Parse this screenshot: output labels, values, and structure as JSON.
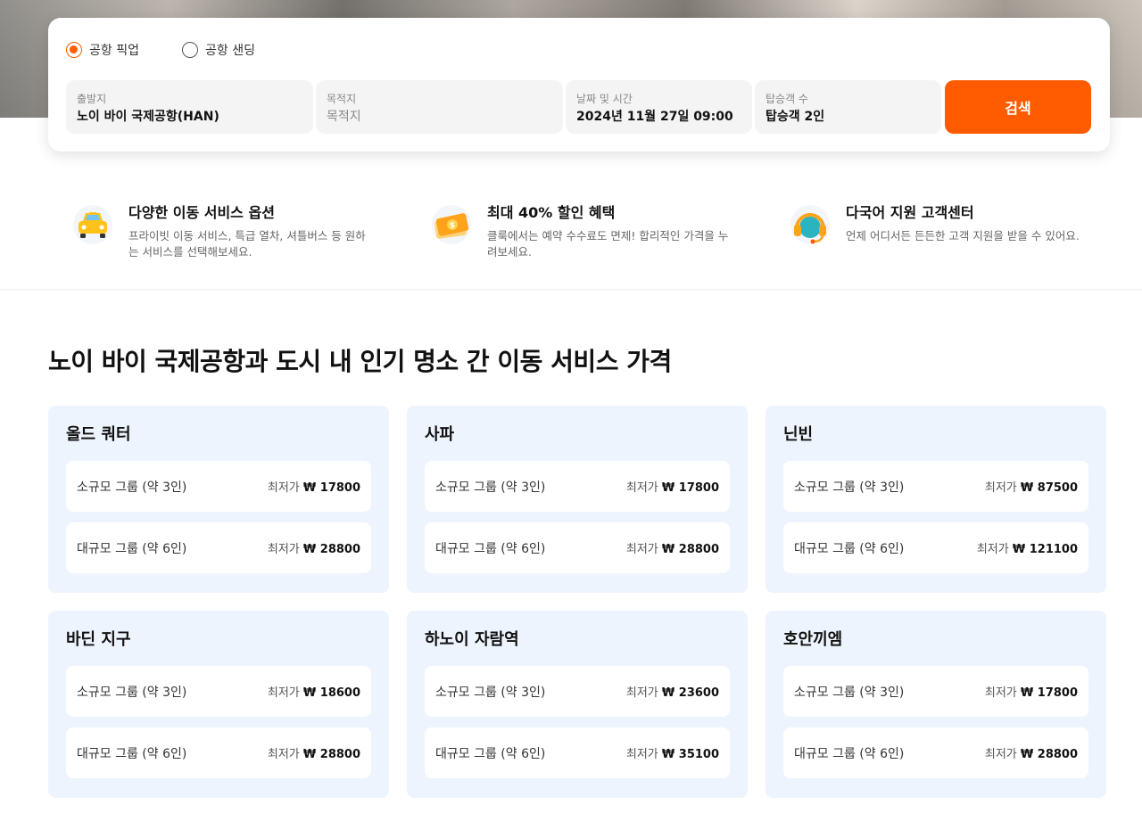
{
  "search": {
    "radio_pickup": "공항 픽업",
    "radio_sending": "공항 샌딩",
    "selected": "pickup",
    "origin_label": "출발지",
    "origin_value": "노이 바이 국제공항(HAN)",
    "dest_label": "목적지",
    "dest_placeholder": "목적지",
    "datetime_label": "날짜 및 시간",
    "datetime_value": "2024년 11월 27일 09:00",
    "passengers_label": "탑승객 수",
    "passengers_value": "탑승객 2인",
    "search_button": "검색",
    "accent_color": "#ff5b00"
  },
  "features": [
    {
      "icon": "car-icon",
      "title": "다양한 이동 서비스 옵션",
      "desc": "프라이빗 이동 서비스, 특급 열차, 셔틀버스 등 원하는 서비스를 선택해보세요."
    },
    {
      "icon": "discount-ticket-icon",
      "title": "최대 40% 할인 혜택",
      "desc": "클룩에서는 예약 수수료도 면제! 합리적인 가격을 누려보세요."
    },
    {
      "icon": "headset-icon",
      "title": "다국어 지원 고객센터",
      "desc": "언제 어디서든 든든한 고객 지원을 받을 수 있어요."
    }
  ],
  "section_title": "노이 바이 국제공항과 도시 내 인기 명소 간 이동 서비스 가격",
  "price_prefix": "최저가 ",
  "destinations": [
    {
      "name": "올드 쿼터",
      "rows": [
        {
          "group": "소규모 그룹 (약 3인)",
          "price": "₩ 17800"
        },
        {
          "group": "대규모 그룹 (약 6인)",
          "price": "₩ 28800"
        }
      ]
    },
    {
      "name": "사파",
      "rows": [
        {
          "group": "소규모 그룹 (약 3인)",
          "price": "₩ 17800"
        },
        {
          "group": "대규모 그룹 (약 6인)",
          "price": "₩ 28800"
        }
      ]
    },
    {
      "name": "닌빈",
      "rows": [
        {
          "group": "소규모 그룹 (약 3인)",
          "price": "₩ 87500"
        },
        {
          "group": "대규모 그룹 (약 6인)",
          "price": "₩ 121100"
        }
      ]
    },
    {
      "name": "바딘 지구",
      "rows": [
        {
          "group": "소규모 그룹 (약 3인)",
          "price": "₩ 18600"
        },
        {
          "group": "대규모 그룹 (약 6인)",
          "price": "₩ 28800"
        }
      ]
    },
    {
      "name": "하노이 자람역",
      "rows": [
        {
          "group": "소규모 그룹 (약 3인)",
          "price": "₩ 23600"
        },
        {
          "group": "대규모 그룹 (약 6인)",
          "price": "₩ 35100"
        }
      ]
    },
    {
      "name": "호안끼엠",
      "rows": [
        {
          "group": "소규모 그룹 (약 3인)",
          "price": "₩ 17800"
        },
        {
          "group": "대규모 그룹 (약 6인)",
          "price": "₩ 28800"
        }
      ]
    }
  ]
}
